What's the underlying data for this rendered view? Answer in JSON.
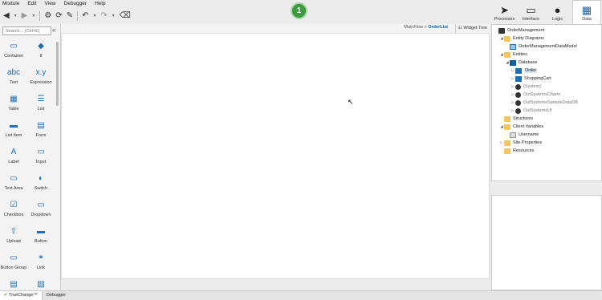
{
  "menu": [
    "Module",
    "Edit",
    "View",
    "Debugger",
    "Help"
  ],
  "publish": {
    "count": "1"
  },
  "nav": [
    {
      "label": "Processes",
      "icon": "processes-icon",
      "glyph": "➤"
    },
    {
      "label": "Interface",
      "icon": "interface-icon",
      "glyph": "▭"
    },
    {
      "label": "Logic",
      "icon": "logic-icon",
      "glyph": "●"
    },
    {
      "label": "Data",
      "icon": "data-icon",
      "glyph": "▦",
      "active": true
    }
  ],
  "toolbox": {
    "search_placeholder": "Search... (Ctrl+E)",
    "tools": [
      {
        "label": "Container",
        "glyph": "▭"
      },
      {
        "label": "If",
        "glyph": "◆"
      },
      {
        "label": "Text",
        "glyph": "abc"
      },
      {
        "label": "Expression",
        "glyph": "x.y"
      },
      {
        "label": "Table",
        "glyph": "▦"
      },
      {
        "label": "List",
        "glyph": "☰"
      },
      {
        "label": "List Item",
        "glyph": "▬"
      },
      {
        "label": "Form",
        "glyph": "▤"
      },
      {
        "label": "Label",
        "glyph": "A"
      },
      {
        "label": "Input",
        "glyph": "▭"
      },
      {
        "label": "Text Area",
        "glyph": "▭"
      },
      {
        "label": "Switch",
        "glyph": "◐"
      },
      {
        "label": "Checkbox",
        "glyph": "☑"
      },
      {
        "label": "Dropdown",
        "glyph": "▭"
      },
      {
        "label": "Upload",
        "glyph": "⇧"
      },
      {
        "label": "Button",
        "glyph": "▬"
      },
      {
        "label": "Button Group",
        "glyph": "▭"
      },
      {
        "label": "Link",
        "glyph": "⚭"
      },
      {
        "label": "",
        "glyph": "▤"
      },
      {
        "label": "",
        "glyph": "▨"
      }
    ]
  },
  "breadcrumb": {
    "flow": "MainFlow",
    "separator": ">",
    "screen": "OrderList"
  },
  "widget_tree": "Widget Tree",
  "tree": {
    "rows": [
      {
        "label": "OrderManagement",
        "indent": 0,
        "arrow": "",
        "icon": "module"
      },
      {
        "label": "Entity Diagrams",
        "indent": 1,
        "arrow": "◢",
        "icon": "folder"
      },
      {
        "label": "OrderManagementDataModel",
        "indent": 2,
        "arrow": "",
        "icon": "diagram"
      },
      {
        "label": "Entities",
        "indent": 1,
        "arrow": "◢",
        "icon": "folder"
      },
      {
        "label": "Database",
        "indent": 2,
        "arrow": "◢",
        "icon": "db"
      },
      {
        "label": "Order",
        "indent": 3,
        "arrow": "▷",
        "icon": "ent",
        "selected": true
      },
      {
        "label": "ShoppingCart",
        "indent": 3,
        "arrow": "▷",
        "icon": "ent"
      },
      {
        "label": "(System)",
        "indent": 3,
        "arrow": "▷",
        "icon": "circle",
        "gray": true
      },
      {
        "label": "OutSystemsCharts",
        "indent": 3,
        "arrow": "▷",
        "icon": "circle",
        "gray": true
      },
      {
        "label": "OutSystemsSampleDataDB",
        "indent": 3,
        "arrow": "▷",
        "icon": "circle",
        "gray": true
      },
      {
        "label": "OutSystemsUI",
        "indent": 3,
        "arrow": "▷",
        "icon": "circle",
        "gray": true
      },
      {
        "label": "Structures",
        "indent": 1,
        "arrow": "",
        "icon": "folder"
      },
      {
        "label": "Client Variables",
        "indent": 1,
        "arrow": "◢",
        "icon": "folder"
      },
      {
        "label": "Username",
        "indent": 2,
        "arrow": "",
        "icon": "var"
      },
      {
        "label": "Site Properties",
        "indent": 1,
        "arrow": "▷",
        "icon": "folder"
      },
      {
        "label": "Resources",
        "indent": 1,
        "arrow": "",
        "icon": "folder"
      }
    ]
  },
  "bottom_tabs": [
    {
      "label": "TrueChange™",
      "active": true
    },
    {
      "label": "Debugger",
      "active": false
    }
  ]
}
